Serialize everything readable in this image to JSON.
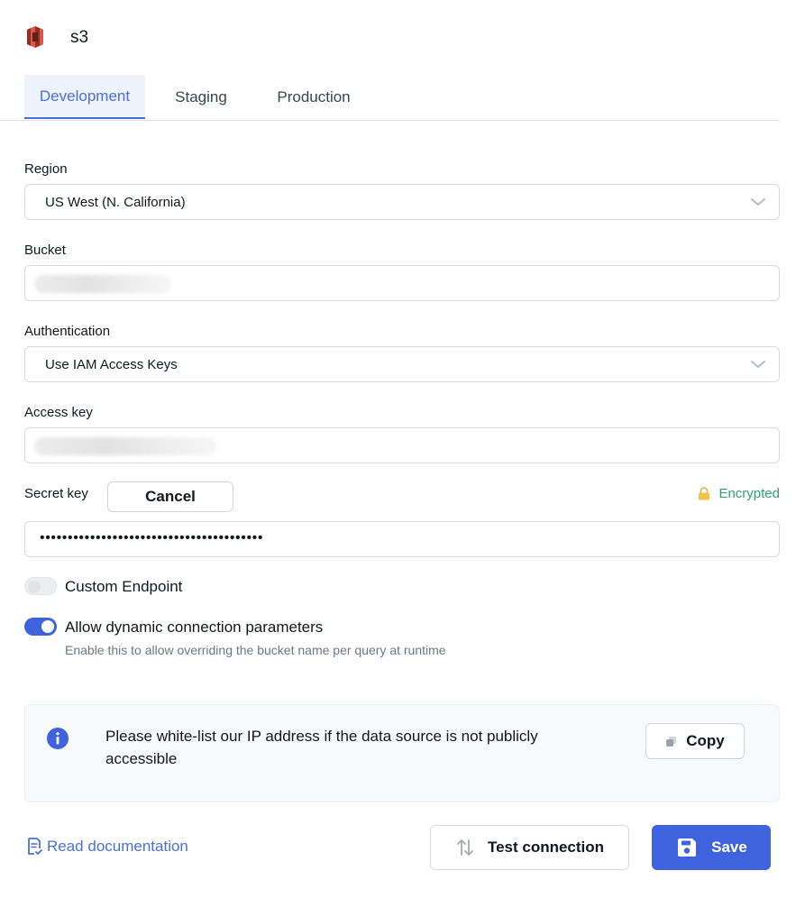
{
  "app": {
    "title": "s3",
    "logo_icon": "aws-s3-logo-icon",
    "brand_color": "#c7402f"
  },
  "tabs": [
    {
      "label": "Development",
      "active": true
    },
    {
      "label": "Staging",
      "active": false
    },
    {
      "label": "Production",
      "active": false
    }
  ],
  "form": {
    "region": {
      "label": "Region",
      "value": "US West (N. California)"
    },
    "bucket": {
      "label": "Bucket",
      "value": ""
    },
    "authentication": {
      "label": "Authentication",
      "value": "Use IAM Access Keys"
    },
    "access_key": {
      "label": "Access key",
      "value": ""
    },
    "secret_key": {
      "label": "Secret key",
      "cancel_label": "Cancel",
      "encrypted_label": "Encrypted",
      "value": "••••••••••••••••••••••••••••••••••••••••"
    }
  },
  "toggles": {
    "custom_endpoint": {
      "label": "Custom Endpoint",
      "enabled": false
    },
    "dynamic_params": {
      "label": "Allow dynamic connection parameters",
      "enabled": true,
      "help": "Enable this to allow overriding the bucket name per query at runtime"
    }
  },
  "info": {
    "text": "Please white-list our IP address if the data source is not publicly accessible",
    "copy_label": "Copy"
  },
  "footer": {
    "doc_label": "Read documentation",
    "test_label": "Test connection",
    "save_label": "Save"
  },
  "colors": {
    "accent": "#3e63dd",
    "success": "#30a46c",
    "lock": "#f0c14b"
  }
}
